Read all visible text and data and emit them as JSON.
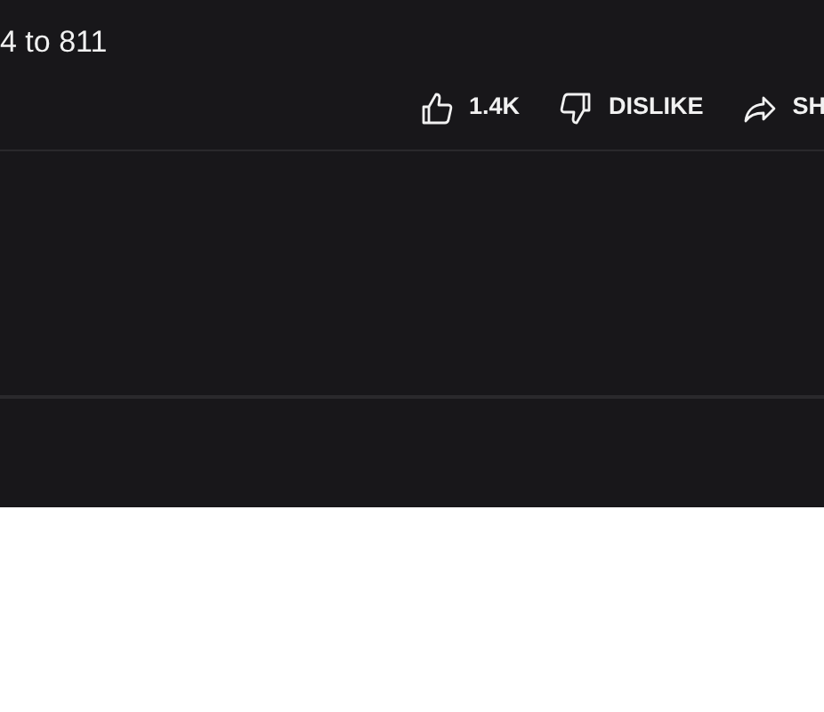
{
  "video": {
    "title": "4 to 811"
  },
  "actions": [
    {
      "kind": "like",
      "label": "1.4K"
    },
    {
      "kind": "dislike",
      "label": "DISLIKE"
    },
    {
      "kind": "share",
      "label": "SH"
    }
  ]
}
